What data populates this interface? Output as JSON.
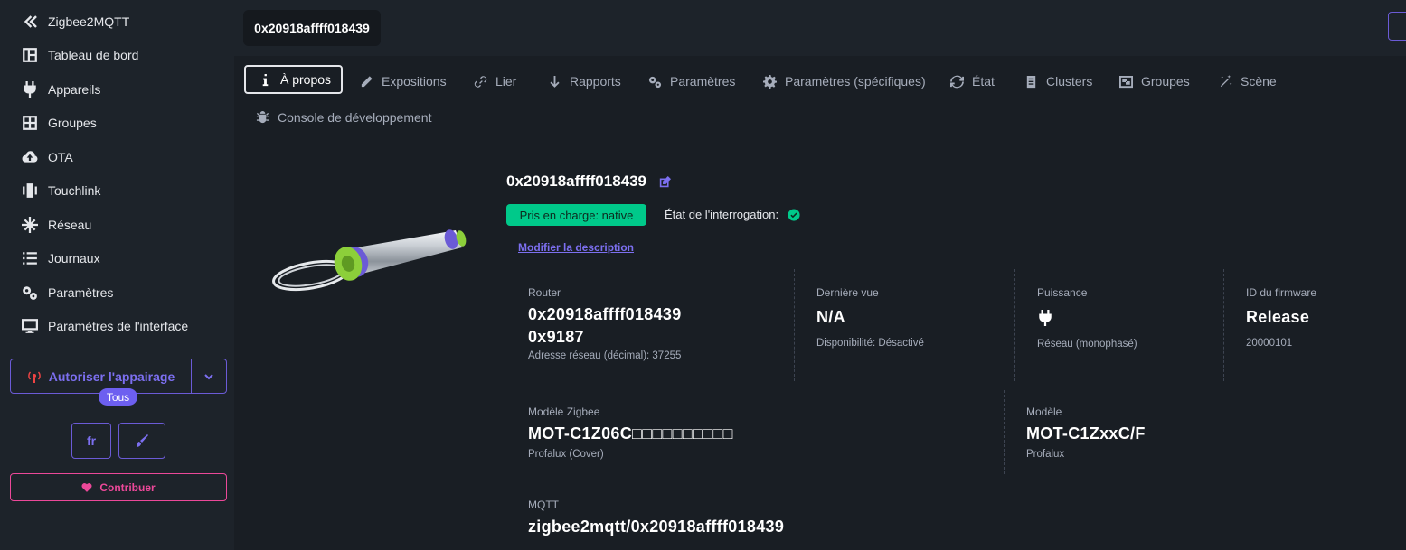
{
  "sidebar": {
    "app_title": "Zigbee2MQTT",
    "items": [
      {
        "label": "Tableau de bord",
        "icon": "dashboard-icon"
      },
      {
        "label": "Appareils",
        "icon": "plug-icon"
      },
      {
        "label": "Groupes",
        "icon": "grid-icon"
      },
      {
        "label": "OTA",
        "icon": "cloud-upload-icon"
      },
      {
        "label": "Touchlink",
        "icon": "touch-icon"
      },
      {
        "label": "Réseau",
        "icon": "network-icon"
      },
      {
        "label": "Journaux",
        "icon": "list-icon"
      },
      {
        "label": "Paramètres",
        "icon": "cogs-icon"
      },
      {
        "label": "Paramètres de l'interface",
        "icon": "monitor-icon"
      }
    ],
    "pair_label": "Autoriser l'appairage",
    "pair_target": "Tous",
    "language": "fr",
    "contribute_label": "Contribuer"
  },
  "header": {
    "device_tab": "0x20918affff018439"
  },
  "tabs": [
    {
      "label": "À propos",
      "icon": "info-icon",
      "active": true
    },
    {
      "label": "Expositions",
      "icon": "pencil-icon"
    },
    {
      "label": "Lier",
      "icon": "link-icon"
    },
    {
      "label": "Rapports",
      "icon": "arrow-down-icon"
    },
    {
      "label": "Paramètres",
      "icon": "cogs-icon"
    },
    {
      "label": "Paramètres (spécifiques)",
      "icon": "gear-icon"
    },
    {
      "label": "État",
      "icon": "refresh-icon"
    },
    {
      "label": "Clusters",
      "icon": "document-icon"
    },
    {
      "label": "Groupes",
      "icon": "object-group-icon"
    },
    {
      "label": "Scène",
      "icon": "magic-icon"
    },
    {
      "label": "Console de développement",
      "icon": "bug-icon"
    }
  ],
  "device": {
    "name": "0x20918affff018439",
    "support_badge": "Pris en charge: native",
    "interrogation_label": "État de l'interrogation:",
    "modify_link": "Modifier la description",
    "router_label": "Router",
    "ieee": "0x20918affff018439",
    "nwk": "0x9187",
    "nwk_decimal": "Adresse réseau (décimal): 37255",
    "last_seen_label": "Dernière vue",
    "last_seen": "N/A",
    "availability": "Disponibilité: Désactivé",
    "power_label": "Puissance",
    "power_source": "Réseau (monophasé)",
    "firmware_label": "ID du firmware",
    "firmware_id": "Release",
    "firmware_date": "20000101",
    "zigbee_model_label": "Modèle Zigbee",
    "zigbee_model": "MOT-C1Z06C□□□□□□□□□□",
    "zigbee_vendor": "Profalux (Cover)",
    "model_label": "Modèle",
    "model": "MOT-C1ZxxC/F",
    "vendor": "Profalux",
    "mqtt_label": "MQTT",
    "mqtt_topic": "zigbee2mqtt/0x20918affff018439"
  },
  "colors": {
    "accent": "#7c6ff0",
    "success": "#00c98a",
    "pink": "#ec4899",
    "background": "#1d232a",
    "panel": "#191e24"
  }
}
